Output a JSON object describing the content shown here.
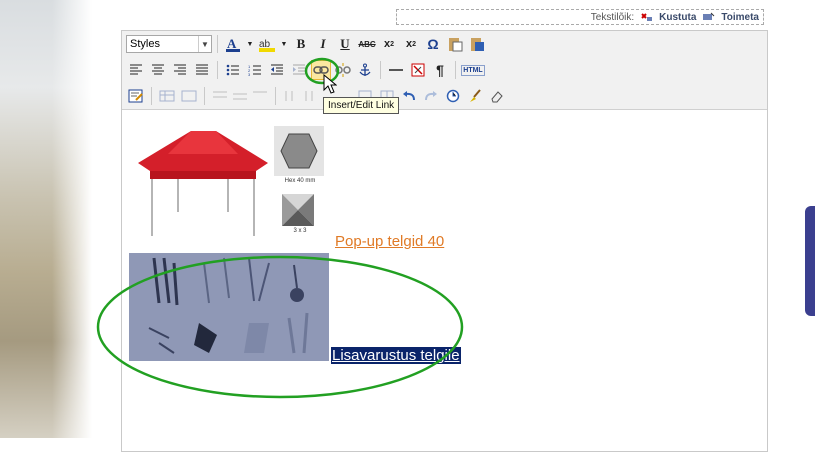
{
  "topbar": {
    "prefix": "Tekstilõik:",
    "delete_label": "Kustuta",
    "edit_label": "Toimeta"
  },
  "toolbar": {
    "styles_value": "Styles",
    "tooltip": "Insert/Edit Link",
    "html_label": "HTML"
  },
  "content": {
    "link1": " Pop-up telgid 40",
    "link2": "Lisavarustus telgile",
    "thumb1_caption": "Hex 40 mm",
    "thumb2_caption": "3 x 3"
  },
  "colors": {
    "annotation": "#22a022",
    "link_orange": "#e07a26",
    "selection": "#0a246a",
    "sidetab": "#3b3f8f"
  }
}
